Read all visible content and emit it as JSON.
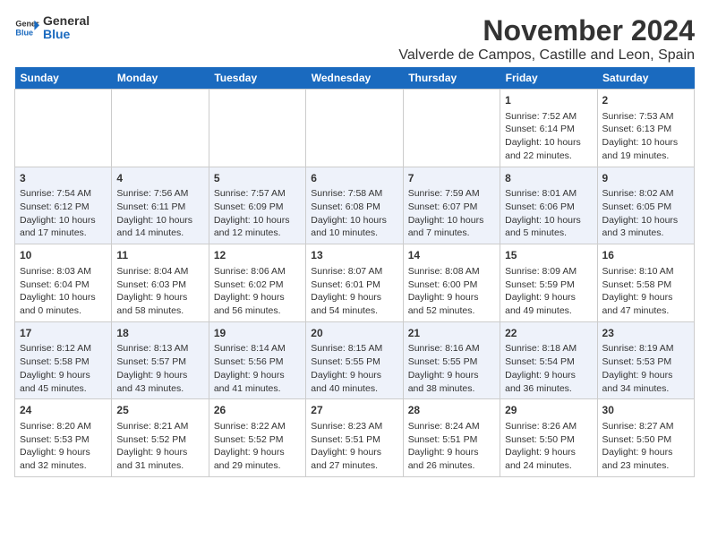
{
  "logo": {
    "line1": "General",
    "line2": "Blue"
  },
  "header": {
    "month": "November 2024",
    "location": "Valverde de Campos, Castille and Leon, Spain"
  },
  "weekdays": [
    "Sunday",
    "Monday",
    "Tuesday",
    "Wednesday",
    "Thursday",
    "Friday",
    "Saturday"
  ],
  "weeks": [
    [
      {
        "day": "",
        "sunrise": "",
        "sunset": "",
        "daylight": ""
      },
      {
        "day": "",
        "sunrise": "",
        "sunset": "",
        "daylight": ""
      },
      {
        "day": "",
        "sunrise": "",
        "sunset": "",
        "daylight": ""
      },
      {
        "day": "",
        "sunrise": "",
        "sunset": "",
        "daylight": ""
      },
      {
        "day": "",
        "sunrise": "",
        "sunset": "",
        "daylight": ""
      },
      {
        "day": "1",
        "sunrise": "Sunrise: 7:52 AM",
        "sunset": "Sunset: 6:14 PM",
        "daylight": "Daylight: 10 hours and 22 minutes."
      },
      {
        "day": "2",
        "sunrise": "Sunrise: 7:53 AM",
        "sunset": "Sunset: 6:13 PM",
        "daylight": "Daylight: 10 hours and 19 minutes."
      }
    ],
    [
      {
        "day": "3",
        "sunrise": "Sunrise: 7:54 AM",
        "sunset": "Sunset: 6:12 PM",
        "daylight": "Daylight: 10 hours and 17 minutes."
      },
      {
        "day": "4",
        "sunrise": "Sunrise: 7:56 AM",
        "sunset": "Sunset: 6:11 PM",
        "daylight": "Daylight: 10 hours and 14 minutes."
      },
      {
        "day": "5",
        "sunrise": "Sunrise: 7:57 AM",
        "sunset": "Sunset: 6:09 PM",
        "daylight": "Daylight: 10 hours and 12 minutes."
      },
      {
        "day": "6",
        "sunrise": "Sunrise: 7:58 AM",
        "sunset": "Sunset: 6:08 PM",
        "daylight": "Daylight: 10 hours and 10 minutes."
      },
      {
        "day": "7",
        "sunrise": "Sunrise: 7:59 AM",
        "sunset": "Sunset: 6:07 PM",
        "daylight": "Daylight: 10 hours and 7 minutes."
      },
      {
        "day": "8",
        "sunrise": "Sunrise: 8:01 AM",
        "sunset": "Sunset: 6:06 PM",
        "daylight": "Daylight: 10 hours and 5 minutes."
      },
      {
        "day": "9",
        "sunrise": "Sunrise: 8:02 AM",
        "sunset": "Sunset: 6:05 PM",
        "daylight": "Daylight: 10 hours and 3 minutes."
      }
    ],
    [
      {
        "day": "10",
        "sunrise": "Sunrise: 8:03 AM",
        "sunset": "Sunset: 6:04 PM",
        "daylight": "Daylight: 10 hours and 0 minutes."
      },
      {
        "day": "11",
        "sunrise": "Sunrise: 8:04 AM",
        "sunset": "Sunset: 6:03 PM",
        "daylight": "Daylight: 9 hours and 58 minutes."
      },
      {
        "day": "12",
        "sunrise": "Sunrise: 8:06 AM",
        "sunset": "Sunset: 6:02 PM",
        "daylight": "Daylight: 9 hours and 56 minutes."
      },
      {
        "day": "13",
        "sunrise": "Sunrise: 8:07 AM",
        "sunset": "Sunset: 6:01 PM",
        "daylight": "Daylight: 9 hours and 54 minutes."
      },
      {
        "day": "14",
        "sunrise": "Sunrise: 8:08 AM",
        "sunset": "Sunset: 6:00 PM",
        "daylight": "Daylight: 9 hours and 52 minutes."
      },
      {
        "day": "15",
        "sunrise": "Sunrise: 8:09 AM",
        "sunset": "Sunset: 5:59 PM",
        "daylight": "Daylight: 9 hours and 49 minutes."
      },
      {
        "day": "16",
        "sunrise": "Sunrise: 8:10 AM",
        "sunset": "Sunset: 5:58 PM",
        "daylight": "Daylight: 9 hours and 47 minutes."
      }
    ],
    [
      {
        "day": "17",
        "sunrise": "Sunrise: 8:12 AM",
        "sunset": "Sunset: 5:58 PM",
        "daylight": "Daylight: 9 hours and 45 minutes."
      },
      {
        "day": "18",
        "sunrise": "Sunrise: 8:13 AM",
        "sunset": "Sunset: 5:57 PM",
        "daylight": "Daylight: 9 hours and 43 minutes."
      },
      {
        "day": "19",
        "sunrise": "Sunrise: 8:14 AM",
        "sunset": "Sunset: 5:56 PM",
        "daylight": "Daylight: 9 hours and 41 minutes."
      },
      {
        "day": "20",
        "sunrise": "Sunrise: 8:15 AM",
        "sunset": "Sunset: 5:55 PM",
        "daylight": "Daylight: 9 hours and 40 minutes."
      },
      {
        "day": "21",
        "sunrise": "Sunrise: 8:16 AM",
        "sunset": "Sunset: 5:55 PM",
        "daylight": "Daylight: 9 hours and 38 minutes."
      },
      {
        "day": "22",
        "sunrise": "Sunrise: 8:18 AM",
        "sunset": "Sunset: 5:54 PM",
        "daylight": "Daylight: 9 hours and 36 minutes."
      },
      {
        "day": "23",
        "sunrise": "Sunrise: 8:19 AM",
        "sunset": "Sunset: 5:53 PM",
        "daylight": "Daylight: 9 hours and 34 minutes."
      }
    ],
    [
      {
        "day": "24",
        "sunrise": "Sunrise: 8:20 AM",
        "sunset": "Sunset: 5:53 PM",
        "daylight": "Daylight: 9 hours and 32 minutes."
      },
      {
        "day": "25",
        "sunrise": "Sunrise: 8:21 AM",
        "sunset": "Sunset: 5:52 PM",
        "daylight": "Daylight: 9 hours and 31 minutes."
      },
      {
        "day": "26",
        "sunrise": "Sunrise: 8:22 AM",
        "sunset": "Sunset: 5:52 PM",
        "daylight": "Daylight: 9 hours and 29 minutes."
      },
      {
        "day": "27",
        "sunrise": "Sunrise: 8:23 AM",
        "sunset": "Sunset: 5:51 PM",
        "daylight": "Daylight: 9 hours and 27 minutes."
      },
      {
        "day": "28",
        "sunrise": "Sunrise: 8:24 AM",
        "sunset": "Sunset: 5:51 PM",
        "daylight": "Daylight: 9 hours and 26 minutes."
      },
      {
        "day": "29",
        "sunrise": "Sunrise: 8:26 AM",
        "sunset": "Sunset: 5:50 PM",
        "daylight": "Daylight: 9 hours and 24 minutes."
      },
      {
        "day": "30",
        "sunrise": "Sunrise: 8:27 AM",
        "sunset": "Sunset: 5:50 PM",
        "daylight": "Daylight: 9 hours and 23 minutes."
      }
    ]
  ]
}
